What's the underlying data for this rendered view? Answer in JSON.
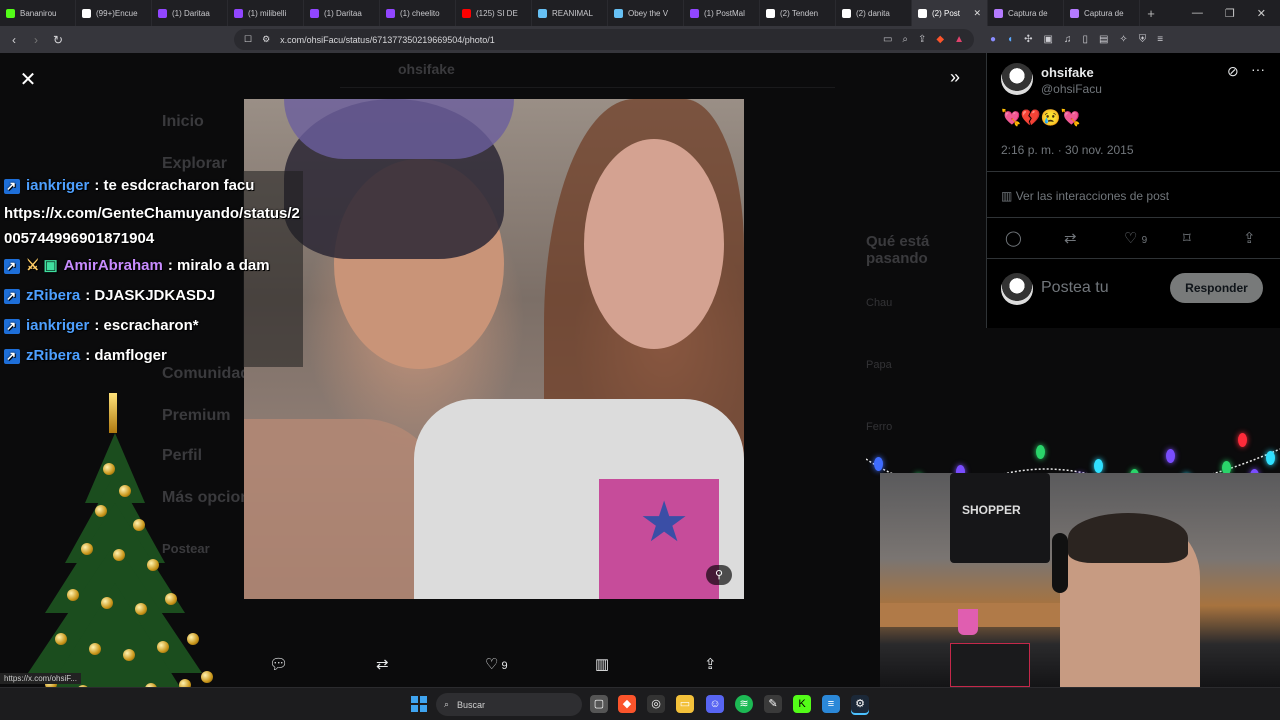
{
  "browser": {
    "tabs": [
      {
        "label": "Bananirou",
        "color": "#53fc18"
      },
      {
        "label": "(99+)Encue",
        "color": "#ffffff"
      },
      {
        "label": "(1) Daritaa",
        "color": "#9146ff"
      },
      {
        "label": "(1) milibelli",
        "color": "#9146ff"
      },
      {
        "label": "(1) Daritaa",
        "color": "#9146ff"
      },
      {
        "label": "(1) cheelito",
        "color": "#9146ff"
      },
      {
        "label": "(125) SI DE",
        "color": "#ff0000"
      },
      {
        "label": "REANIMAL",
        "color": "#66c0f4"
      },
      {
        "label": "Obey the V",
        "color": "#66c0f4"
      },
      {
        "label": "(1) PostMal",
        "color": "#9146ff"
      },
      {
        "label": "(2) Tenden",
        "color": "#ffffff"
      },
      {
        "label": "(2) danita",
        "color": "#ffffff"
      },
      {
        "label": "(2) Post",
        "color": "#ffffff",
        "active": true
      },
      {
        "label": "Captura de",
        "color": "#b57bff"
      },
      {
        "label": "Captura de",
        "color": "#b57bff"
      }
    ],
    "url": "x.com/ohsiFacu/status/671377350219669504/photo/1",
    "status_url": "https://x.com/ohsiF..."
  },
  "background_nav": {
    "header": "ohsifake",
    "items": [
      "Inicio",
      "Explorar",
      "Comunidades",
      "Premium",
      "Perfil",
      "Más opciones"
    ],
    "post_button": "Postear",
    "right_heading": "Qué está pasando",
    "right_items": [
      "Chau",
      "Papa",
      "Ferro"
    ]
  },
  "viewer": {
    "actions": {
      "reply_icon": "reply-icon",
      "repost_icon": "repost-icon",
      "like_icon": "heart-icon",
      "like_count": "9",
      "views_icon": "views-icon",
      "share_icon": "share-icon"
    }
  },
  "chat": [
    {
      "user": "iankriger",
      "message": ": te esdcracharon facu",
      "color": "#4ea0ff"
    },
    {
      "user": "",
      "message": "https://x.com/GenteChamuyando/status/2005744996901871904",
      "color": "#ffffff"
    },
    {
      "user": "AmirAbraham",
      "message": ": miralo a dam",
      "color": "#c88cff"
    },
    {
      "user": "zRibera",
      "message": ": DJASKJDKASDJ",
      "color": "#4ea0ff"
    },
    {
      "user": "iankriger",
      "message": ": escracharon*",
      "color": "#4ea0ff"
    },
    {
      "user": "zRibera",
      "message": ": damfloger",
      "color": "#4ea0ff"
    }
  ],
  "tweet": {
    "name": "ohsifake",
    "handle": "@ohsiFacu",
    "emojis": "💘💔😢💘",
    "timestamp": "2:16 p. m. · 30 nov. 2015",
    "interactions_link": "Ver las interacciones de post",
    "like_count": "9",
    "reply_placeholder": "Postea tu",
    "reply_button": "Responder"
  },
  "webcam": {
    "poster_text": "SHOPPER"
  },
  "taskbar": {
    "search_placeholder": "Buscar"
  }
}
